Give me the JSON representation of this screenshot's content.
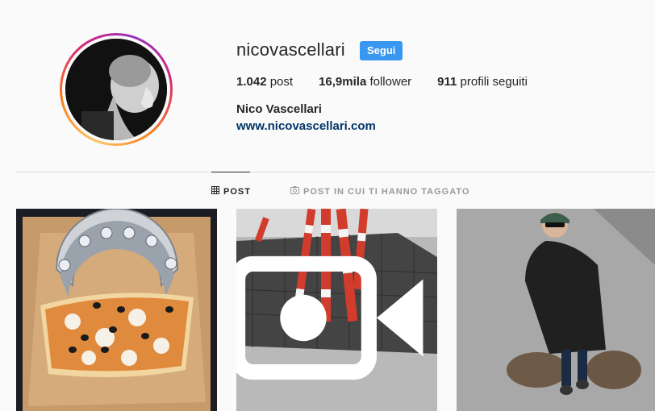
{
  "profile": {
    "username": "nicovascellari",
    "follow_label": "Segui",
    "full_name": "Nico Vascellari",
    "website": "www.nicovascellari.com",
    "stats": [
      {
        "value": "1.042",
        "label": "post"
      },
      {
        "value": "16,9mila",
        "label": "follower"
      },
      {
        "value": "911",
        "label": "profili seguiti"
      }
    ]
  },
  "tabs": {
    "posts": {
      "label": "POST",
      "icon": "grid-icon"
    },
    "tagged": {
      "label": "POST IN CUI TI HANNO TAGGATO",
      "icon": "tag-photo-icon"
    }
  },
  "colors": {
    "accent": "#3897f0",
    "link": "#003569",
    "text": "#262626",
    "muted": "#999999",
    "background": "#fafafa"
  },
  "posts": [
    {
      "subject": "pizza box with metal sculpture",
      "is_video": false
    },
    {
      "subject": "red and white barrier tape on grate",
      "is_video": true
    },
    {
      "subject": "man in black coat standing on pavement",
      "is_video": false
    }
  ]
}
